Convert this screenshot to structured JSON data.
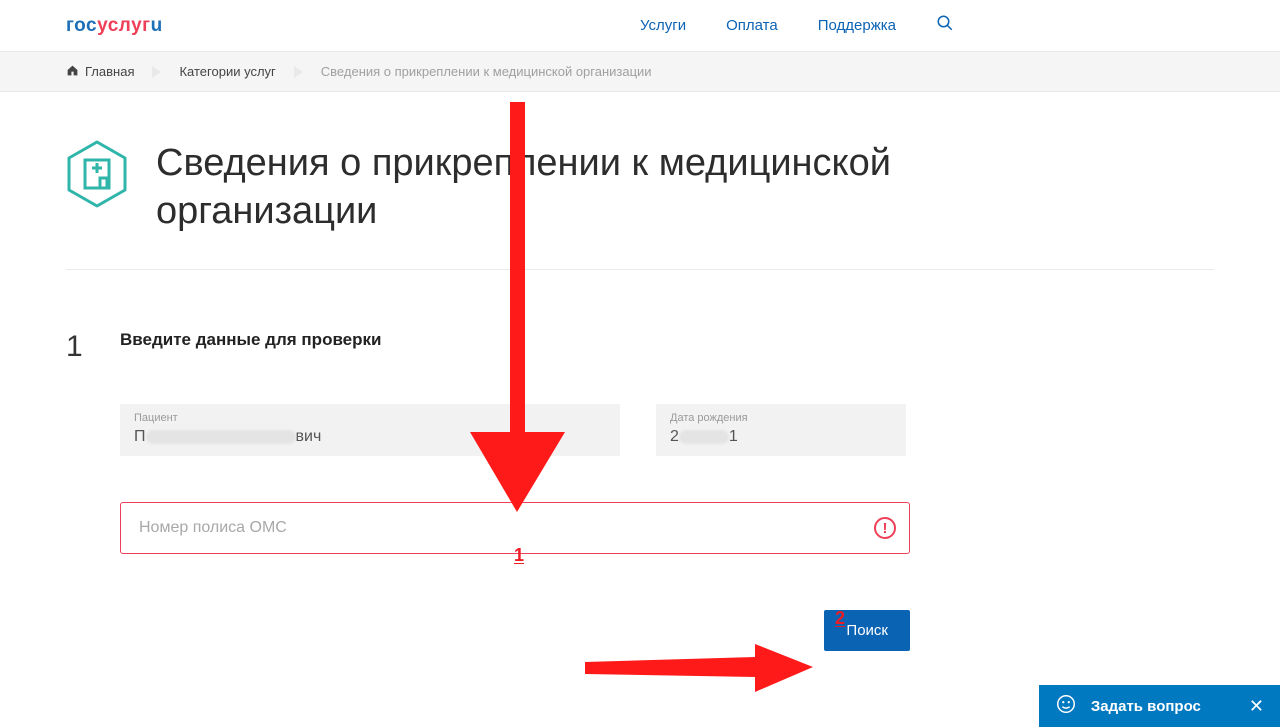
{
  "logo": {
    "p1": "гос",
    "p2": "услуг",
    "p3": "u"
  },
  "nav": {
    "items": [
      "Услуги",
      "Оплата",
      "Поддержка"
    ]
  },
  "breadcrumb": {
    "home": "Главная",
    "categories": "Категории услуг",
    "current": "Сведения о прикреплении к медицинской организации"
  },
  "page": {
    "title": "Сведения о прикреплении к медицинской организации"
  },
  "step": {
    "number": "1",
    "title": "Введите данные для проверки"
  },
  "fields": {
    "patient": {
      "label": "Пациент",
      "prefix": "П",
      "suffix": "вич"
    },
    "dob": {
      "label": "Дата рождения",
      "prefix": "2",
      "suffix": "1"
    },
    "oms": {
      "placeholder": "Номер полиса ОМС",
      "value": "",
      "error_glyph": "!"
    }
  },
  "annotations": {
    "num1": "1",
    "num2": "2"
  },
  "button": {
    "search": "Поиск"
  },
  "widget": {
    "ask": "Задать вопрос",
    "close": "✕"
  }
}
